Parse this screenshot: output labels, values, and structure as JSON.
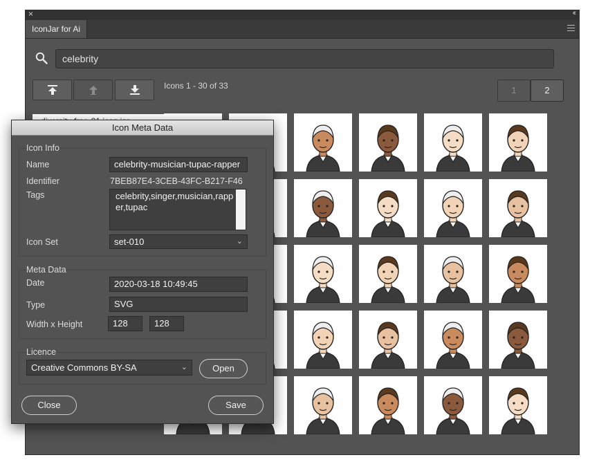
{
  "panel": {
    "tab_label": "IconJar for Ai",
    "close_glyph": "×",
    "collapse_glyph": "‹‹"
  },
  "search": {
    "value": "celebrity"
  },
  "toolbar": {
    "range_label": "Icons 1 - 30 of 33"
  },
  "pagination": {
    "pages": [
      "1",
      "2"
    ],
    "current": "2"
  },
  "grid": {
    "hidden_item_label": "diversity-free-01 icon jar"
  },
  "dialog": {
    "title": "Icon Meta Data",
    "icon_info": {
      "heading": "Icon Info",
      "name_label": "Name",
      "name_value": "celebrity-musician-tupac-rapper",
      "identifier_label": "Identifier",
      "identifier_value": "7BEB87E4-3CEB-43FC-B217-F46",
      "tags_label": "Tags",
      "tags_value": "celebrity,singer,musician,rapper,tupac",
      "icon_set_label": "Icon Set",
      "icon_set_value": "set-010"
    },
    "meta": {
      "heading": "Meta Data",
      "date_label": "Date",
      "date_value": "2020-03-18 10:49:45",
      "type_label": "Type",
      "type_value": "SVG",
      "wh_label": "Width x Height",
      "width_value": "128",
      "height_value": "128"
    },
    "licence": {
      "heading": "Licence",
      "value": "Creative Commons BY-SA",
      "open_label": "Open"
    },
    "close_label": "Close",
    "save_label": "Save"
  },
  "colors": {
    "panel_bg": "#535353",
    "field_bg": "#3f3f3f",
    "title_bar": "#d6d6d6"
  }
}
